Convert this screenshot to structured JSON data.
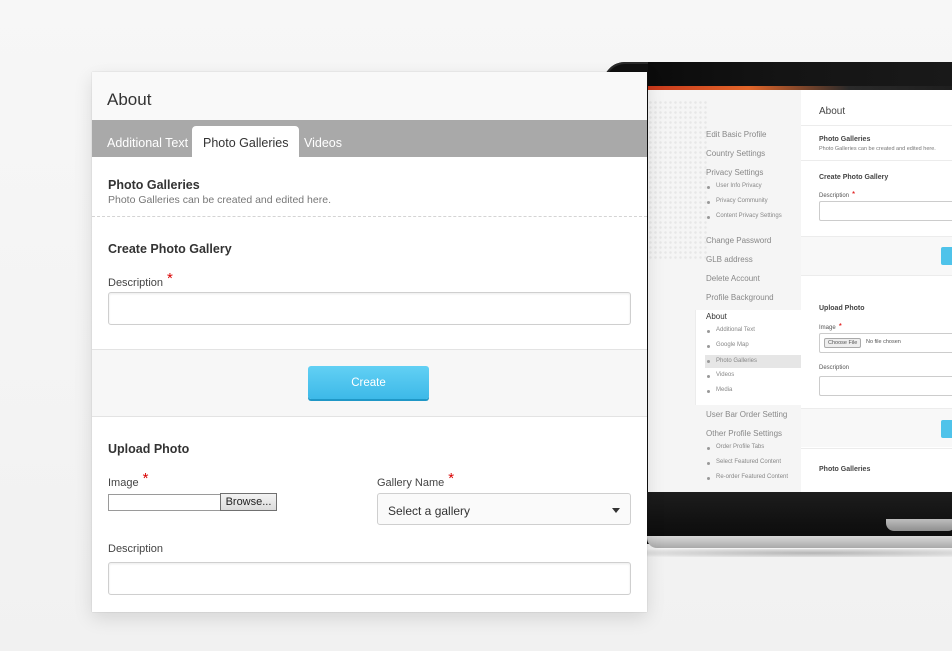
{
  "panel": {
    "title": "About",
    "tabs": [
      "Additional Text",
      "Photo Galleries",
      "Videos"
    ],
    "active_tab": "Photo Galleries",
    "galleries_section": {
      "title": "Photo Galleries",
      "subtitle": "Photo Galleries can be created and edited here."
    },
    "create_section": {
      "title": "Create Photo Gallery",
      "description_label": "Description",
      "required_mark": "*",
      "description_value": "",
      "button_label": "Create"
    },
    "upload_section": {
      "title": "Upload Photo",
      "image_label": "Image",
      "required_mark": "*",
      "browse_label": "Browse...",
      "gallery_label": "Gallery Name",
      "gallery_selected": "Select a gallery",
      "description_label": "Description",
      "description_value": ""
    }
  },
  "laptop_screen": {
    "sidebar": {
      "links": [
        "Edit Basic Profile",
        "Country Settings",
        "Privacy Settings"
      ],
      "privacy_sub": [
        "User Info Privacy",
        "Privacy Community",
        "Content Privacy Settings"
      ],
      "links2": [
        "Change Password",
        "GLB address",
        "Delete Account",
        "Profile Background"
      ],
      "about": "About",
      "about_sub": [
        "Additional Text",
        "Google Map",
        "Photo Galleries",
        "Videos",
        "Media"
      ],
      "links3": [
        "User Bar Order Setting",
        "Other Profile Settings"
      ],
      "other_sub": [
        "Order Profile Tabs",
        "Select Featured Content",
        "Re-order Featured Content"
      ]
    },
    "main": {
      "title": "About",
      "galleries_title": "Photo Galleries",
      "galleries_sub": "Photo Galleries can be created and edited here.",
      "create_title": "Create Photo Gallery",
      "description_label": "Description",
      "upload_title": "Upload Photo",
      "image_label": "Image",
      "choose_file": "Choose File",
      "no_file": "No file chosen",
      "description_label2": "Description",
      "footer_title": "Photo Galleries"
    }
  },
  "colors": {
    "tab_bar": "#a9a9a9",
    "create_button": "#4fc3ea",
    "required": "#d90000"
  }
}
